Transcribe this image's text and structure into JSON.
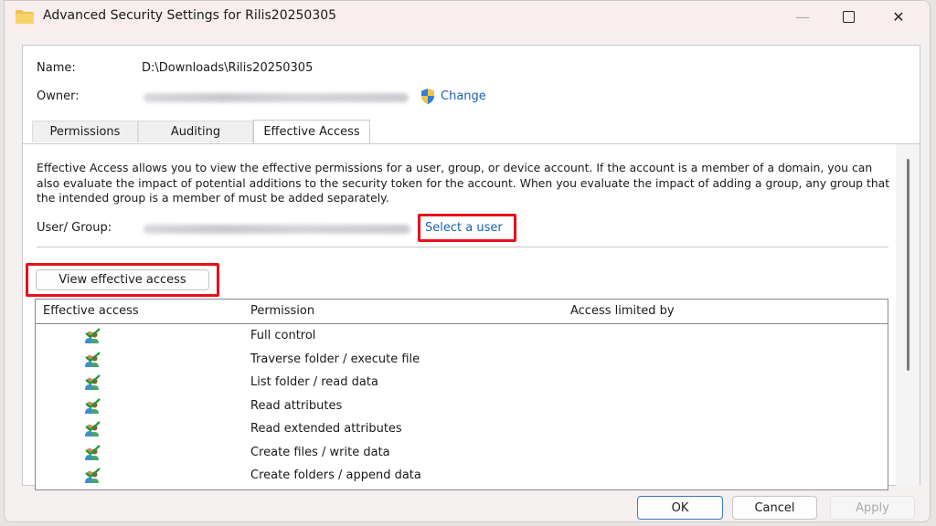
{
  "window": {
    "title": "Advanced Security Settings for Rilis20250305",
    "icon": "folder-icon",
    "controls": {
      "minimize": "—",
      "close": "✕"
    }
  },
  "info": {
    "name_label": "Name:",
    "name_value": "D:\\Downloads\\Rilis20250305",
    "owner_label": "Owner:",
    "owner_value_blurred": true,
    "change_link": "Change",
    "change_icon": "uac-shield-icon"
  },
  "tabs": [
    {
      "label": "Permissions",
      "active": false
    },
    {
      "label": "Auditing",
      "active": false
    },
    {
      "label": "Effective Access",
      "active": true
    }
  ],
  "effective_access": {
    "description": "Effective Access allows you to view the effective permissions for a user, group, or device account. If the account is a member of a domain, you can also evaluate the impact of potential additions to the security token for the account. When you evaluate the impact of adding a group, any group that the intended group is a member of must be added separately.",
    "user_group_label": "User/ Group:",
    "user_group_value_blurred": true,
    "select_user_link": "Select a user",
    "view_button": "View effective access",
    "highlight_color": "#e8101c"
  },
  "table": {
    "columns": [
      "Effective access",
      "Permission",
      "Access limited by"
    ],
    "rows": [
      {
        "access_icon": "allowed-user-check-icon",
        "permission": "Full control",
        "limited_by": ""
      },
      {
        "access_icon": "allowed-user-check-icon",
        "permission": "Traverse folder / execute file",
        "limited_by": ""
      },
      {
        "access_icon": "allowed-user-check-icon",
        "permission": "List folder / read data",
        "limited_by": ""
      },
      {
        "access_icon": "allowed-user-check-icon",
        "permission": "Read attributes",
        "limited_by": ""
      },
      {
        "access_icon": "allowed-user-check-icon",
        "permission": "Read extended attributes",
        "limited_by": ""
      },
      {
        "access_icon": "allowed-user-check-icon",
        "permission": "Create files / write data",
        "limited_by": ""
      },
      {
        "access_icon": "allowed-user-check-icon",
        "permission": "Create folders / append data",
        "limited_by": ""
      }
    ]
  },
  "footer": {
    "ok": "OK",
    "cancel": "Cancel",
    "apply": "Apply",
    "apply_enabled": false
  }
}
